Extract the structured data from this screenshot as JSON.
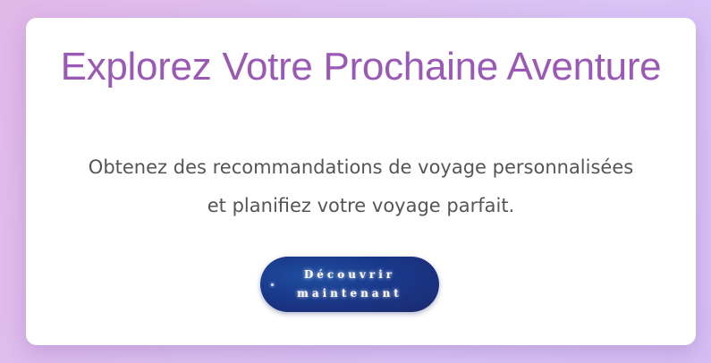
{
  "hero": {
    "title": "Explorez Votre Prochaine Aventure",
    "subtitle": "Obtenez des recommandations de voyage personnalisées et planifiez votre voyage parfait.",
    "cta_label": "Découvrir maintenant"
  },
  "colors": {
    "title": "#9b59b6",
    "subtitle": "#555555",
    "button": "#1b2a6e"
  }
}
